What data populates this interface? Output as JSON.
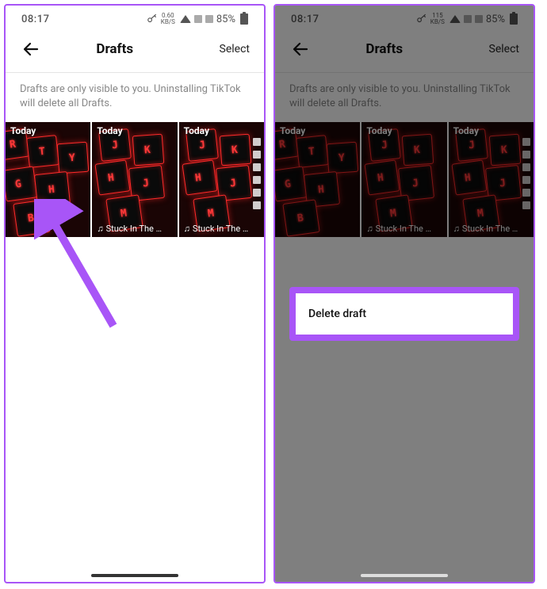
{
  "status": {
    "time": "08:17",
    "net_speed_top": "0.60",
    "net_speed_bottom": "KB/S",
    "net_speed_top2": "115",
    "net_speed_bottom2": "KB/S",
    "battery_pct": "85%"
  },
  "header": {
    "title": "Drafts",
    "select_label": "Select"
  },
  "hint": "Drafts are only visible to you. Uninstalling TikTok will delete all Drafts.",
  "drafts": [
    {
      "date": "Today",
      "caption": ""
    },
    {
      "date": "Today",
      "caption": "Stuck In The …"
    },
    {
      "date": "Today",
      "caption": "Stuck In The …"
    }
  ],
  "sheet": {
    "delete_label": "Delete draft"
  }
}
